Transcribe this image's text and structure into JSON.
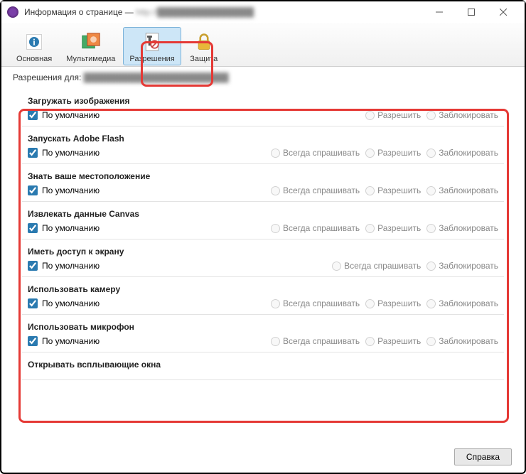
{
  "window": {
    "title_prefix": "Информация о странице — ",
    "title_url": "http://████████████████"
  },
  "toolbar": {
    "items": [
      {
        "label": "Основная"
      },
      {
        "label": "Мультимедиа"
      },
      {
        "label": "Разрешения"
      },
      {
        "label": "Защита"
      }
    ]
  },
  "subheader": {
    "label": "Разрешения для:",
    "url": "████████████████████████"
  },
  "options": {
    "default": "По умолчанию",
    "always_ask": "Всегда спрашивать",
    "allow": "Разрешить",
    "block": "Заблокировать"
  },
  "permissions": [
    {
      "title": "Загружать изображения",
      "opts": [
        "allow",
        "block"
      ]
    },
    {
      "title": "Запускать Adobe Flash",
      "opts": [
        "always_ask",
        "allow",
        "block"
      ]
    },
    {
      "title": "Знать ваше местоположение",
      "opts": [
        "always_ask",
        "allow",
        "block"
      ]
    },
    {
      "title": "Извлекать данные Canvas",
      "opts": [
        "always_ask",
        "allow",
        "block"
      ]
    },
    {
      "title": "Иметь доступ к экрану",
      "opts": [
        "always_ask",
        "block"
      ]
    },
    {
      "title": "Использовать камеру",
      "opts": [
        "always_ask",
        "allow",
        "block"
      ]
    },
    {
      "title": "Использовать микрофон",
      "opts": [
        "always_ask",
        "allow",
        "block"
      ]
    },
    {
      "title": "Открывать всплывающие окна",
      "opts": []
    }
  ],
  "footer": {
    "help": "Справка"
  }
}
